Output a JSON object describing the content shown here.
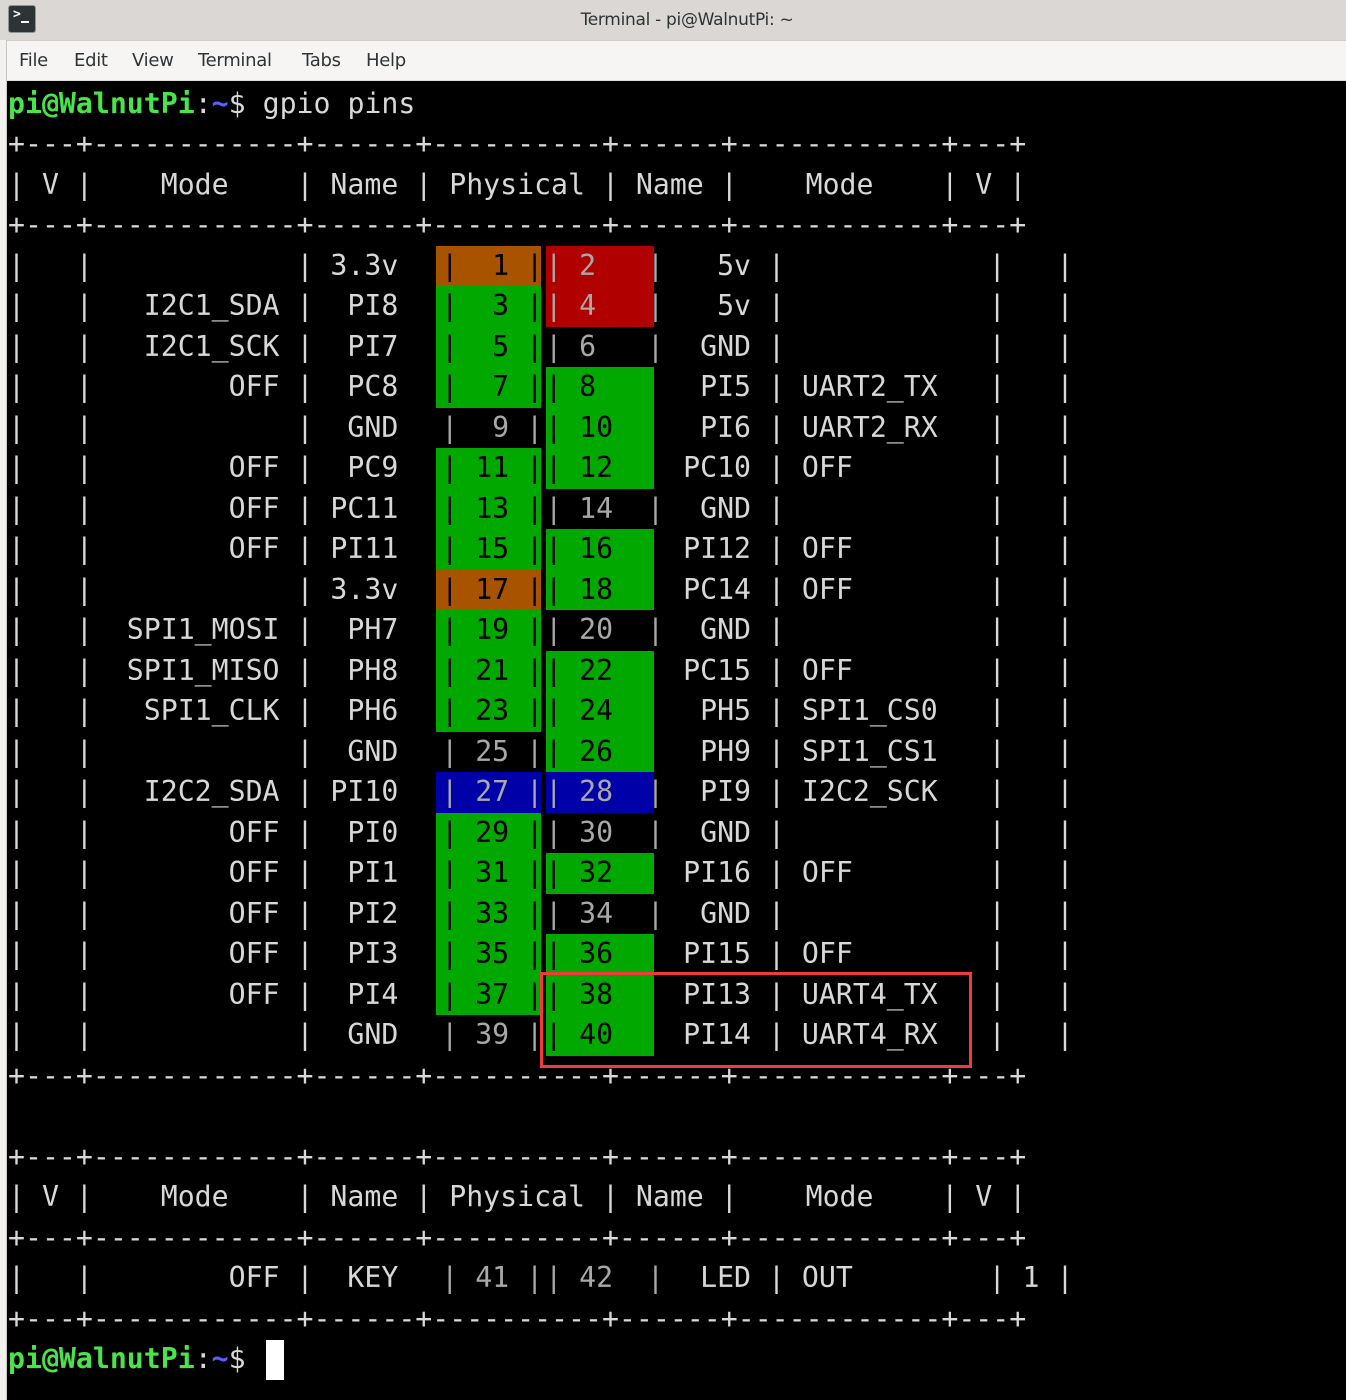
{
  "window": {
    "title": "Terminal - pi@WalnutPi: ~",
    "app_icon": "terminal-icon"
  },
  "menubar": {
    "items": [
      "File",
      "Edit",
      "View",
      "Terminal",
      "Tabs",
      "Help"
    ]
  },
  "prompt": {
    "user_host": "pi@WalnutPi",
    "colon": ":",
    "path": "~",
    "dollar": "$",
    "command": " gpio pins"
  },
  "colors": {
    "power_3v3": "#a85300",
    "power_5v": "#b00000",
    "gpio": "#00a800",
    "i2c": "#0000a8",
    "ground": "#000000",
    "highlight_box": "#ef3b3b",
    "prompt_green": "#4be34b",
    "prompt_blue": "#5c5cff"
  },
  "table": {
    "border": "+---+------------+------+----------+------+------------+---+",
    "headers": [
      "V",
      "Mode",
      "Name",
      "Physical",
      "Name",
      "Mode",
      "V"
    ],
    "rows": [
      {
        "lv": "",
        "lmode": "",
        "lname": "3.3v",
        "lpin": "1",
        "rpin": "2",
        "rname": "5v",
        "rmode": "",
        "rv": "",
        "lcolor": "power_3v3",
        "rcolor": "power_5v"
      },
      {
        "lv": "",
        "lmode": "I2C1_SDA",
        "lname": "PI8",
        "lpin": "3",
        "rpin": "4",
        "rname": "5v",
        "rmode": "",
        "rv": "",
        "lcolor": "gpio",
        "rcolor": "power_5v"
      },
      {
        "lv": "",
        "lmode": "I2C1_SCK",
        "lname": "PI7",
        "lpin": "5",
        "rpin": "6",
        "rname": "GND",
        "rmode": "",
        "rv": "",
        "lcolor": "gpio",
        "rcolor": "ground"
      },
      {
        "lv": "",
        "lmode": "OFF",
        "lname": "PC8",
        "lpin": "7",
        "rpin": "8",
        "rname": "PI5",
        "rmode": "UART2_TX",
        "rv": "",
        "lcolor": "gpio",
        "rcolor": "gpio"
      },
      {
        "lv": "",
        "lmode": "",
        "lname": "GND",
        "lpin": "9",
        "rpin": "10",
        "rname": "PI6",
        "rmode": "UART2_RX",
        "rv": "",
        "lcolor": "ground",
        "rcolor": "gpio"
      },
      {
        "lv": "",
        "lmode": "OFF",
        "lname": "PC9",
        "lpin": "11",
        "rpin": "12",
        "rname": "PC10",
        "rmode": "OFF",
        "rv": "",
        "lcolor": "gpio",
        "rcolor": "gpio"
      },
      {
        "lv": "",
        "lmode": "OFF",
        "lname": "PC11",
        "lpin": "13",
        "rpin": "14",
        "rname": "GND",
        "rmode": "",
        "rv": "",
        "lcolor": "gpio",
        "rcolor": "ground"
      },
      {
        "lv": "",
        "lmode": "OFF",
        "lname": "PI11",
        "lpin": "15",
        "rpin": "16",
        "rname": "PI12",
        "rmode": "OFF",
        "rv": "",
        "lcolor": "gpio",
        "rcolor": "gpio"
      },
      {
        "lv": "",
        "lmode": "",
        "lname": "3.3v",
        "lpin": "17",
        "rpin": "18",
        "rname": "PC14",
        "rmode": "OFF",
        "rv": "",
        "lcolor": "power_3v3",
        "rcolor": "gpio"
      },
      {
        "lv": "",
        "lmode": "SPI1_MOSI",
        "lname": "PH7",
        "lpin": "19",
        "rpin": "20",
        "rname": "GND",
        "rmode": "",
        "rv": "",
        "lcolor": "gpio",
        "rcolor": "ground"
      },
      {
        "lv": "",
        "lmode": "SPI1_MISO",
        "lname": "PH8",
        "lpin": "21",
        "rpin": "22",
        "rname": "PC15",
        "rmode": "OFF",
        "rv": "",
        "lcolor": "gpio",
        "rcolor": "gpio"
      },
      {
        "lv": "",
        "lmode": "SPI1_CLK",
        "lname": "PH6",
        "lpin": "23",
        "rpin": "24",
        "rname": "PH5",
        "rmode": "SPI1_CS0",
        "rv": "",
        "lcolor": "gpio",
        "rcolor": "gpio"
      },
      {
        "lv": "",
        "lmode": "",
        "lname": "GND",
        "lpin": "25",
        "rpin": "26",
        "rname": "PH9",
        "rmode": "SPI1_CS1",
        "rv": "",
        "lcolor": "ground",
        "rcolor": "gpio"
      },
      {
        "lv": "",
        "lmode": "I2C2_SDA",
        "lname": "PI10",
        "lpin": "27",
        "rpin": "28",
        "rname": "PI9",
        "rmode": "I2C2_SCK",
        "rv": "",
        "lcolor": "i2c",
        "rcolor": "i2c"
      },
      {
        "lv": "",
        "lmode": "OFF",
        "lname": "PI0",
        "lpin": "29",
        "rpin": "30",
        "rname": "GND",
        "rmode": "",
        "rv": "",
        "lcolor": "gpio",
        "rcolor": "ground"
      },
      {
        "lv": "",
        "lmode": "OFF",
        "lname": "PI1",
        "lpin": "31",
        "rpin": "32",
        "rname": "PI16",
        "rmode": "OFF",
        "rv": "",
        "lcolor": "gpio",
        "rcolor": "gpio"
      },
      {
        "lv": "",
        "lmode": "OFF",
        "lname": "PI2",
        "lpin": "33",
        "rpin": "34",
        "rname": "GND",
        "rmode": "",
        "rv": "",
        "lcolor": "gpio",
        "rcolor": "ground"
      },
      {
        "lv": "",
        "lmode": "OFF",
        "lname": "PI3",
        "lpin": "35",
        "rpin": "36",
        "rname": "PI15",
        "rmode": "OFF",
        "rv": "",
        "lcolor": "gpio",
        "rcolor": "gpio"
      },
      {
        "lv": "",
        "lmode": "OFF",
        "lname": "PI4",
        "lpin": "37",
        "rpin": "38",
        "rname": "PI13",
        "rmode": "UART4_TX",
        "rv": "",
        "lcolor": "gpio",
        "rcolor": "gpio"
      },
      {
        "lv": "",
        "lmode": "",
        "lname": "GND",
        "lpin": "39",
        "rpin": "40",
        "rname": "PI14",
        "rmode": "UART4_RX",
        "rv": "",
        "lcolor": "ground",
        "rcolor": "gpio"
      }
    ]
  },
  "table2": {
    "rows": [
      {
        "lv": "",
        "lmode": "OFF",
        "lname": "KEY",
        "lpin": "41",
        "rpin": "42",
        "rname": "LED",
        "rmode": "OUT",
        "rv": "1",
        "lcolor": "ground",
        "rcolor": "ground"
      }
    ]
  },
  "annotation": {
    "highlighted_pins": [
      "38",
      "40"
    ],
    "highlighted_names": [
      "PI13",
      "PI14"
    ],
    "highlighted_modes": [
      "UART4_TX",
      "UART4_RX"
    ]
  }
}
